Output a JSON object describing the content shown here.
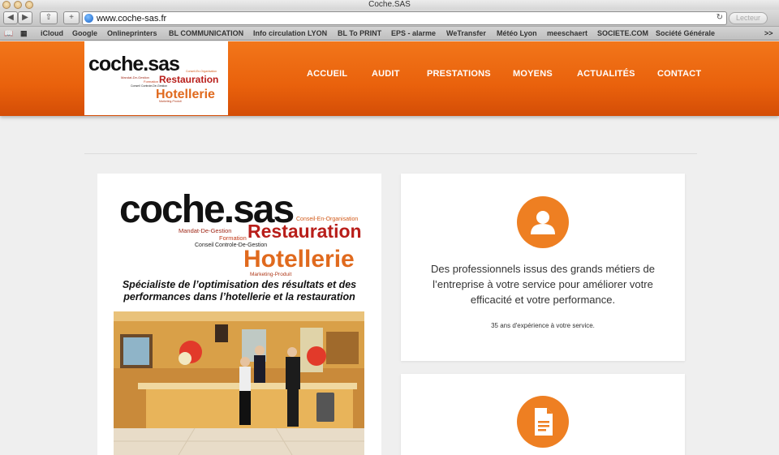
{
  "window": {
    "title": "Coche.SAS"
  },
  "browser": {
    "url": "www.coche-sas.fr",
    "reader_label": "Lecteur",
    "bookmarks": [
      "iCloud",
      "Google",
      "Onlineprinters",
      "BL COMMUNICATION",
      "Info circulation LYON",
      "BL To PRINT",
      "EPS - alarme",
      "WeTransfer",
      "Météo Lyon",
      "meeschaert",
      "SOCIETE.COM",
      "Société Générale"
    ],
    "overflow_label": ">>"
  },
  "logo": {
    "brand": "coche.sas",
    "words": {
      "conseil_org": "Conseil-En-Organisation",
      "mandat": "Mandat-De-Gestion",
      "formation": "Formation",
      "conseil": "Conseil",
      "controle": "Controle-De-Gestion",
      "restauration": "Restauration",
      "hotellerie": "Hotellerie",
      "marketing": "Marketing-Produit"
    }
  },
  "nav": {
    "items": [
      "ACCUEIL",
      "AUDIT",
      "PRESTATIONS",
      "MOYENS",
      "ACTUALITÉS",
      "CONTACT"
    ]
  },
  "main": {
    "tagline_line1": "Spécialiste de l’optimisation des résultats et des",
    "tagline_line2": "performances dans l’hotellerie et la restauration"
  },
  "cards": [
    {
      "icon": "user-icon",
      "text_line1": "Des professionnels issus des grands métiers de",
      "text_line2": "l’entreprise à votre service pour améliorer votre",
      "text_line3": "efficacité et votre performance.",
      "small": "35 ans d'expérience à votre service."
    },
    {
      "icon": "document-icon"
    }
  ],
  "colors": {
    "accent": "#ee7f22",
    "header": "#e9610c",
    "brand_red": "#c8321e",
    "brand_orange": "#e06a1e"
  }
}
